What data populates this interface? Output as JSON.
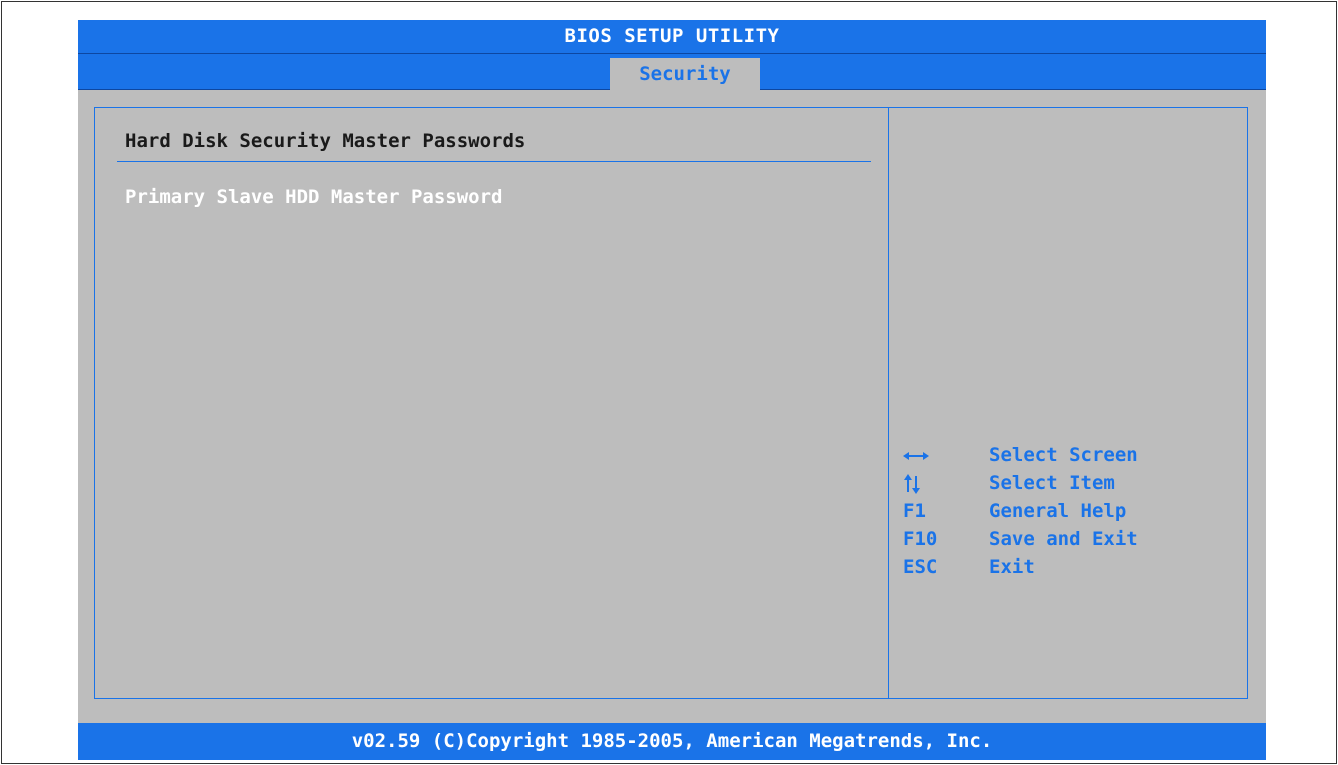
{
  "window": {
    "title": "BIOS SETUP UTILITY"
  },
  "tabs": [
    {
      "label": "Security",
      "selected": true
    }
  ],
  "main": {
    "section_title": "Hard Disk Security Master Passwords",
    "items": [
      {
        "label": "Primary Slave HDD Master Password",
        "highlighted": true
      }
    ]
  },
  "help": {
    "keys": [
      {
        "key_icon": "left-right-arrow-icon",
        "key": "",
        "desc": "Select Screen"
      },
      {
        "key_icon": "up-down-arrow-icon",
        "key": "",
        "desc": "Select Item"
      },
      {
        "key": "F1",
        "desc": "General Help"
      },
      {
        "key": "F10",
        "desc": "Save and Exit"
      },
      {
        "key": "ESC",
        "desc": "Exit"
      }
    ]
  },
  "footer": {
    "copyright": "v02.59 (C)Copyright 1985-2005, American Megatrends, Inc."
  },
  "colors": {
    "accent": "#1a73e8",
    "panel_bg": "#bdbdbd",
    "text_dark": "#1a1a1a",
    "text_light": "#ffffff"
  }
}
